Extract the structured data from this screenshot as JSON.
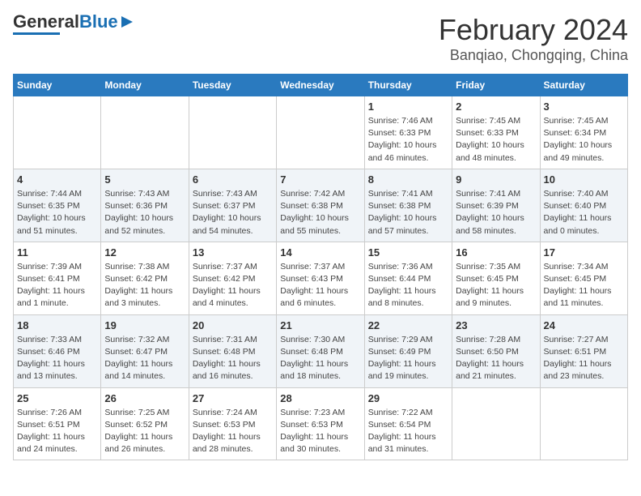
{
  "header": {
    "logo_general": "General",
    "logo_blue": "Blue",
    "month_title": "February 2024",
    "location": "Banqiao, Chongqing, China"
  },
  "weekdays": [
    "Sunday",
    "Monday",
    "Tuesday",
    "Wednesday",
    "Thursday",
    "Friday",
    "Saturday"
  ],
  "weeks": [
    [
      {
        "day": "",
        "info": ""
      },
      {
        "day": "",
        "info": ""
      },
      {
        "day": "",
        "info": ""
      },
      {
        "day": "",
        "info": ""
      },
      {
        "day": "1",
        "info": "Sunrise: 7:46 AM\nSunset: 6:33 PM\nDaylight: 10 hours\nand 46 minutes."
      },
      {
        "day": "2",
        "info": "Sunrise: 7:45 AM\nSunset: 6:33 PM\nDaylight: 10 hours\nand 48 minutes."
      },
      {
        "day": "3",
        "info": "Sunrise: 7:45 AM\nSunset: 6:34 PM\nDaylight: 10 hours\nand 49 minutes."
      }
    ],
    [
      {
        "day": "4",
        "info": "Sunrise: 7:44 AM\nSunset: 6:35 PM\nDaylight: 10 hours\nand 51 minutes."
      },
      {
        "day": "5",
        "info": "Sunrise: 7:43 AM\nSunset: 6:36 PM\nDaylight: 10 hours\nand 52 minutes."
      },
      {
        "day": "6",
        "info": "Sunrise: 7:43 AM\nSunset: 6:37 PM\nDaylight: 10 hours\nand 54 minutes."
      },
      {
        "day": "7",
        "info": "Sunrise: 7:42 AM\nSunset: 6:38 PM\nDaylight: 10 hours\nand 55 minutes."
      },
      {
        "day": "8",
        "info": "Sunrise: 7:41 AM\nSunset: 6:38 PM\nDaylight: 10 hours\nand 57 minutes."
      },
      {
        "day": "9",
        "info": "Sunrise: 7:41 AM\nSunset: 6:39 PM\nDaylight: 10 hours\nand 58 minutes."
      },
      {
        "day": "10",
        "info": "Sunrise: 7:40 AM\nSunset: 6:40 PM\nDaylight: 11 hours\nand 0 minutes."
      }
    ],
    [
      {
        "day": "11",
        "info": "Sunrise: 7:39 AM\nSunset: 6:41 PM\nDaylight: 11 hours\nand 1 minute."
      },
      {
        "day": "12",
        "info": "Sunrise: 7:38 AM\nSunset: 6:42 PM\nDaylight: 11 hours\nand 3 minutes."
      },
      {
        "day": "13",
        "info": "Sunrise: 7:37 AM\nSunset: 6:42 PM\nDaylight: 11 hours\nand 4 minutes."
      },
      {
        "day": "14",
        "info": "Sunrise: 7:37 AM\nSunset: 6:43 PM\nDaylight: 11 hours\nand 6 minutes."
      },
      {
        "day": "15",
        "info": "Sunrise: 7:36 AM\nSunset: 6:44 PM\nDaylight: 11 hours\nand 8 minutes."
      },
      {
        "day": "16",
        "info": "Sunrise: 7:35 AM\nSunset: 6:45 PM\nDaylight: 11 hours\nand 9 minutes."
      },
      {
        "day": "17",
        "info": "Sunrise: 7:34 AM\nSunset: 6:45 PM\nDaylight: 11 hours\nand 11 minutes."
      }
    ],
    [
      {
        "day": "18",
        "info": "Sunrise: 7:33 AM\nSunset: 6:46 PM\nDaylight: 11 hours\nand 13 minutes."
      },
      {
        "day": "19",
        "info": "Sunrise: 7:32 AM\nSunset: 6:47 PM\nDaylight: 11 hours\nand 14 minutes."
      },
      {
        "day": "20",
        "info": "Sunrise: 7:31 AM\nSunset: 6:48 PM\nDaylight: 11 hours\nand 16 minutes."
      },
      {
        "day": "21",
        "info": "Sunrise: 7:30 AM\nSunset: 6:48 PM\nDaylight: 11 hours\nand 18 minutes."
      },
      {
        "day": "22",
        "info": "Sunrise: 7:29 AM\nSunset: 6:49 PM\nDaylight: 11 hours\nand 19 minutes."
      },
      {
        "day": "23",
        "info": "Sunrise: 7:28 AM\nSunset: 6:50 PM\nDaylight: 11 hours\nand 21 minutes."
      },
      {
        "day": "24",
        "info": "Sunrise: 7:27 AM\nSunset: 6:51 PM\nDaylight: 11 hours\nand 23 minutes."
      }
    ],
    [
      {
        "day": "25",
        "info": "Sunrise: 7:26 AM\nSunset: 6:51 PM\nDaylight: 11 hours\nand 24 minutes."
      },
      {
        "day": "26",
        "info": "Sunrise: 7:25 AM\nSunset: 6:52 PM\nDaylight: 11 hours\nand 26 minutes."
      },
      {
        "day": "27",
        "info": "Sunrise: 7:24 AM\nSunset: 6:53 PM\nDaylight: 11 hours\nand 28 minutes."
      },
      {
        "day": "28",
        "info": "Sunrise: 7:23 AM\nSunset: 6:53 PM\nDaylight: 11 hours\nand 30 minutes."
      },
      {
        "day": "29",
        "info": "Sunrise: 7:22 AM\nSunset: 6:54 PM\nDaylight: 11 hours\nand 31 minutes."
      },
      {
        "day": "",
        "info": ""
      },
      {
        "day": "",
        "info": ""
      }
    ]
  ]
}
